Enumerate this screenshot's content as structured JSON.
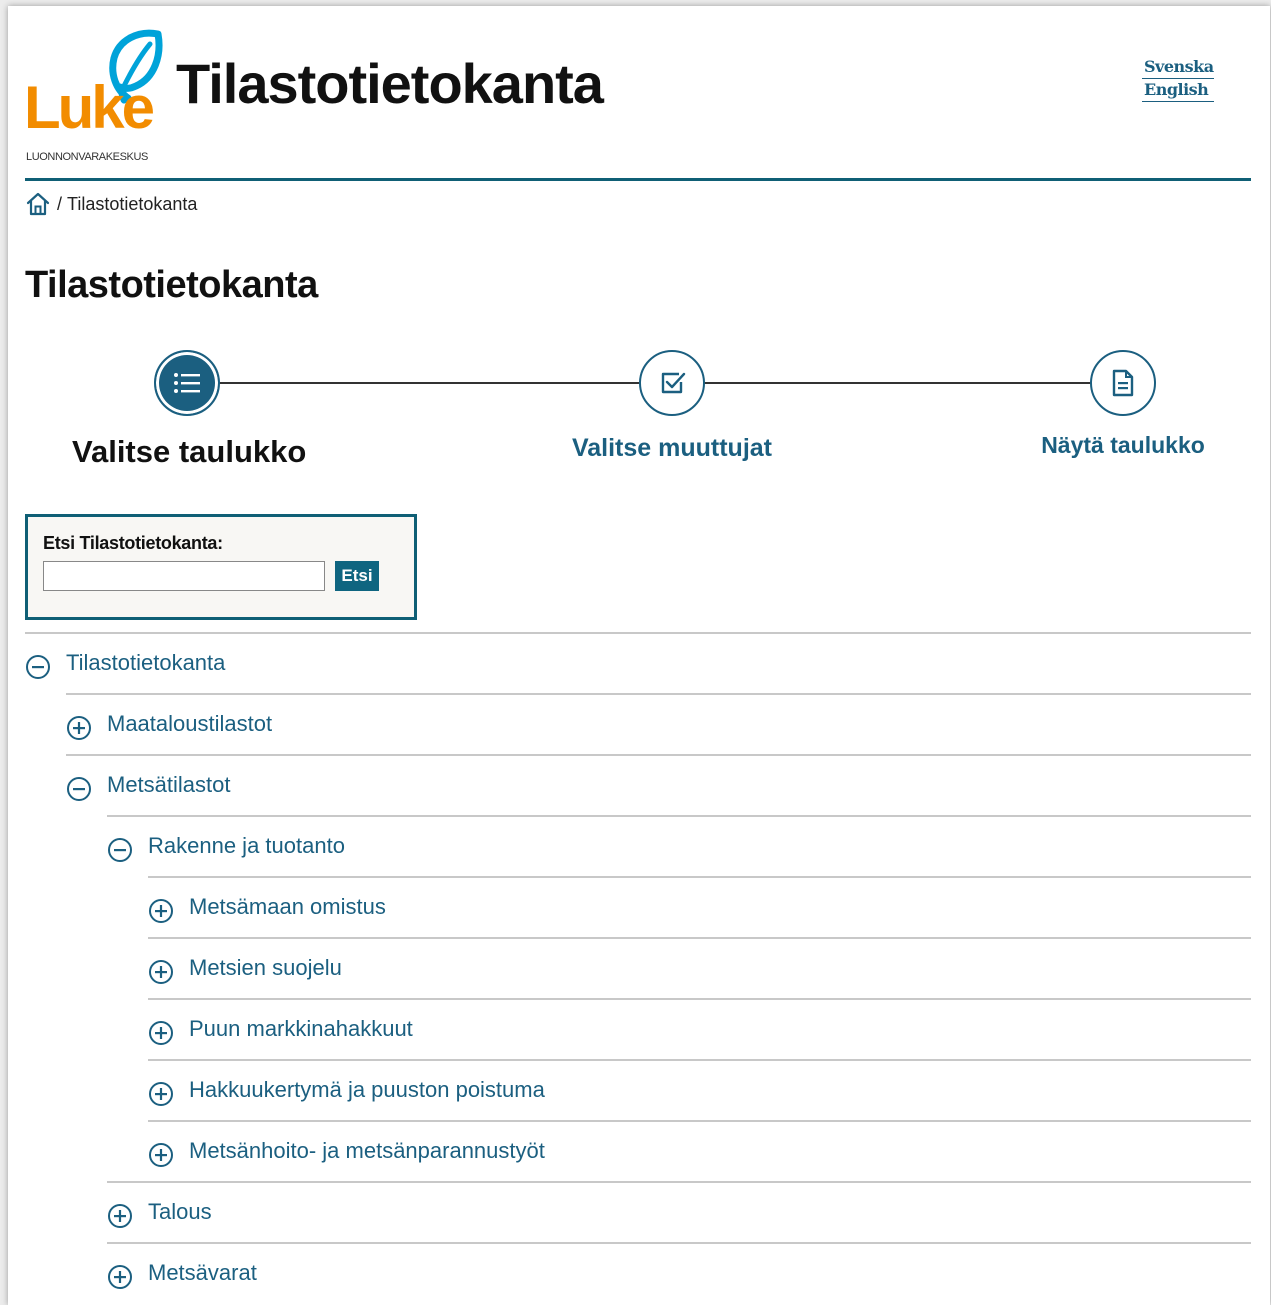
{
  "header": {
    "logo_word": "Luke",
    "logo_subtitle": "LUONNONVARAKESKUS",
    "site_title": "Tilastotietokanta",
    "languages": [
      "Svenska",
      "English"
    ]
  },
  "breadcrumb": {
    "separator": "/",
    "current": "Tilastotietokanta"
  },
  "page_title": "Tilastotietokanta",
  "stepper": {
    "steps": [
      {
        "label": "Valitse taulukko",
        "icon": "list-icon",
        "active": true
      },
      {
        "label": "Valitse muuttujat",
        "icon": "checkbox-icon",
        "active": false
      },
      {
        "label": "Näytä taulukko",
        "icon": "document-icon",
        "active": false
      }
    ]
  },
  "search": {
    "label": "Etsi Tilastotietokanta:",
    "value": "",
    "button": "Etsi"
  },
  "tree": [
    {
      "label": "Tilastotietokanta",
      "state": "expanded",
      "level": 0
    },
    {
      "label": "Maataloustilastot",
      "state": "collapsed",
      "level": 1
    },
    {
      "label": "Metsätilastot",
      "state": "expanded",
      "level": 1
    },
    {
      "label": "Rakenne ja tuotanto",
      "state": "expanded",
      "level": 2
    },
    {
      "label": "Metsämaan omistus",
      "state": "collapsed",
      "level": 3
    },
    {
      "label": "Metsien suojelu",
      "state": "collapsed",
      "level": 3
    },
    {
      "label": "Puun markkinahakkuut",
      "state": "collapsed",
      "level": 3
    },
    {
      "label": "Hakkuukertymä ja puuston poistuma",
      "state": "collapsed",
      "level": 3
    },
    {
      "label": "Metsänhoito- ja metsänparannustyöt",
      "state": "collapsed",
      "level": 3
    },
    {
      "label": "Talous",
      "state": "collapsed",
      "level": 2
    },
    {
      "label": "Metsävarat",
      "state": "collapsed",
      "level": 2
    }
  ],
  "colors": {
    "accent": "#1b5f80",
    "rule": "#0f5f75",
    "logo_orange": "#f28c00",
    "logo_cyan": "#00a3d9"
  }
}
